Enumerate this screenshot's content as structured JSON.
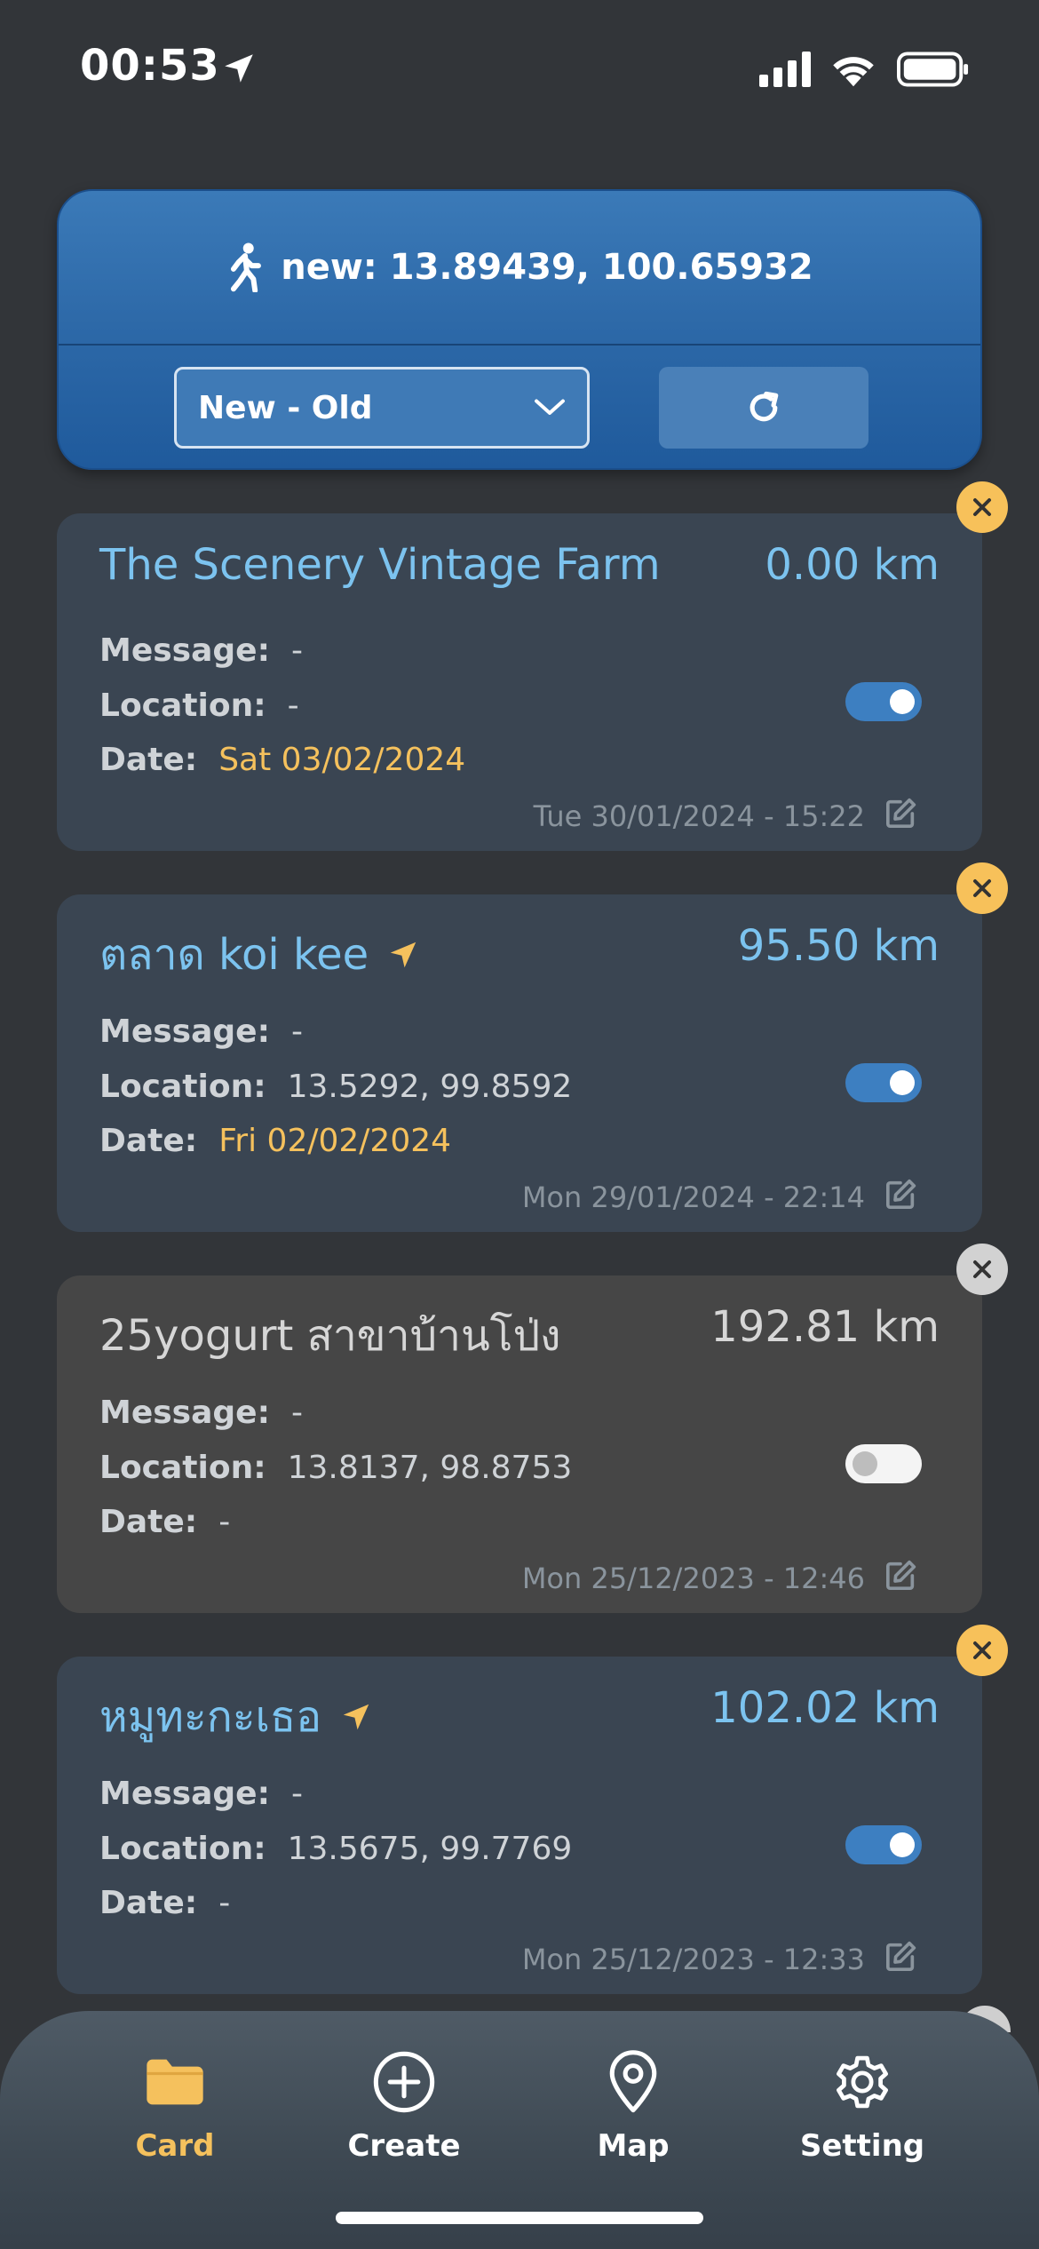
{
  "status_bar": {
    "time": "00:53"
  },
  "header": {
    "coords_text": "new: 13.89439, 100.65932",
    "sort_selected": "New - Old"
  },
  "cards": [
    {
      "title": "The Scenery Vintage Farm",
      "distance": "0.00 km",
      "message_label": "Message:",
      "message": "-",
      "location_label": "Location:",
      "location": "-",
      "date_label": "Date:",
      "date": "Sat 03/02/2024",
      "timestamp": "Tue 30/01/2024 - 15:22",
      "enabled": true
    },
    {
      "title": "ตลาด koi kee",
      "distance": "95.50 km",
      "message_label": "Message:",
      "message": "-",
      "location_label": "Location:",
      "location": "13.5292, 99.8592",
      "date_label": "Date:",
      "date": "Fri 02/02/2024",
      "timestamp": "Mon 29/01/2024 - 22:14",
      "enabled": true
    },
    {
      "title": "25yogurt สาขาบ้านโป่ง",
      "distance": "192.81 km",
      "message_label": "Message:",
      "message": "-",
      "location_label": "Location:",
      "location": "13.8137, 98.8753",
      "date_label": "Date:",
      "date": "-",
      "timestamp": "Mon 25/12/2023 - 12:46",
      "enabled": false
    },
    {
      "title": "หมูทะกะเธอ",
      "distance": "102.02 km",
      "message_label": "Message:",
      "message": "-",
      "location_label": "Location:",
      "location": "13.5675, 99.7769",
      "date_label": "Date:",
      "date": "-",
      "timestamp": "Mon 25/12/2023 - 12:33",
      "enabled": true
    }
  ],
  "tabs": [
    {
      "label": "Card",
      "icon": "folder-icon",
      "active": true
    },
    {
      "label": "Create",
      "icon": "plus-circle-icon",
      "active": false
    },
    {
      "label": "Map",
      "icon": "map-pin-icon",
      "active": false
    },
    {
      "label": "Setting",
      "icon": "gear-icon",
      "active": false
    }
  ],
  "colors": {
    "background": "#323539",
    "header_blue": "#2e6aa9",
    "accent_yellow": "#f5c15d",
    "title_blue": "#7cc3ef",
    "card_bg": "#3a4552",
    "card_inactive_bg": "#464646"
  }
}
